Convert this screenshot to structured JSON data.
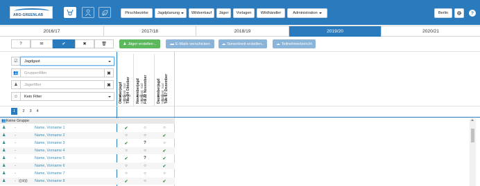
{
  "app": {
    "logo_text": "ARO-GREENLAB"
  },
  "nav": {
    "buttons": [
      {
        "label": "Pirschbezirke",
        "dropdown": false
      },
      {
        "label": "Jagdplanung",
        "dropdown": true
      },
      {
        "label": "Wildverkauf",
        "dropdown": false
      },
      {
        "label": "Jäger",
        "dropdown": false
      },
      {
        "label": "Vorlagen",
        "dropdown": false
      },
      {
        "label": "Wildhändler",
        "dropdown": false
      },
      {
        "label": "Administration",
        "dropdown": true
      }
    ],
    "location": "Berlin",
    "icons": [
      "deer-icon",
      "person-icon",
      "leaf-icon",
      "gear-icon",
      "help-icon"
    ]
  },
  "years": [
    "2016/17",
    "2017/18",
    "2018/19",
    "2019/20",
    "2020/21"
  ],
  "selected_year": "2019/20",
  "toolbar": {
    "filter_buttons": [
      "?",
      "✉",
      "✔",
      "✖",
      "🗑"
    ],
    "actions": [
      {
        "label": "Jäger erstellen ..",
        "color": "#5cb85c"
      },
      {
        "label": "E-Mails verschicken",
        "color": "#8ab4d8"
      },
      {
        "label": "Sonenbrett erstellen..",
        "color": "#8ab4d8"
      },
      {
        "label": "Teilnehmerbericht",
        "color": "#8ab4d8"
      }
    ]
  },
  "filters": {
    "type_value": "Jagdgast",
    "group_placeholder": "Gruppenfilter",
    "hunter_placeholder": "Jägerfilter",
    "status_value": "Kein Filter"
  },
  "events": [
    {
      "title": "Oktoberjagd",
      "location": "Stadtwald, Süd",
      "date": "Thu 24 Oktober",
      "hunters": "19/50",
      "guests": "4/25"
    },
    {
      "title": "Novemberjagd",
      "location": "Stadtwald, Süd",
      "date": "Fri 22 November",
      "hunters": "6/50",
      "guests": "1/25"
    },
    {
      "title": "Dezemberjagd",
      "location": "Stadtwald, Süd",
      "date": "Tue 17 Dezember",
      "hunters": "7/50",
      "guests": "2/25"
    }
  ],
  "pagination": {
    "pages": [
      "1",
      "2",
      "3",
      "4"
    ],
    "current": "1"
  },
  "group_label": "Keine Gruppe",
  "rows": [
    {
      "extra": "",
      "name": "Name, Vorname 1",
      "cells": [
        "ok",
        "o",
        "o"
      ]
    },
    {
      "extra": "",
      "name": "Name, Vorname 2",
      "cells": [
        "o",
        "o",
        "ok"
      ]
    },
    {
      "extra": "",
      "name": "Name, Vorname 3",
      "cells": [
        "ok",
        "?",
        "o"
      ]
    },
    {
      "extra": "",
      "name": "Name, Vorname 4",
      "cells": [
        "o",
        "o",
        "ok"
      ]
    },
    {
      "extra": "",
      "name": "Name, Vorname 5",
      "cells": [
        "ok",
        "?",
        "ok"
      ]
    },
    {
      "extra": "",
      "name": "Name, Vorname 6",
      "cells": [
        "o",
        "o",
        "ok"
      ]
    },
    {
      "extra": "",
      "name": "Name, Vorname 7",
      "cells": [
        "o",
        "o",
        "o"
      ]
    },
    {
      "extra": "(((⚙)))",
      "name": "Name, Vorname 8",
      "cells": [
        "ok",
        "o",
        "ok"
      ]
    }
  ],
  "colors": {
    "brand": "#2a7bbd",
    "success": "#5cb85c",
    "action_disabled": "#8ab4d8",
    "link": "#3a8fb6"
  }
}
